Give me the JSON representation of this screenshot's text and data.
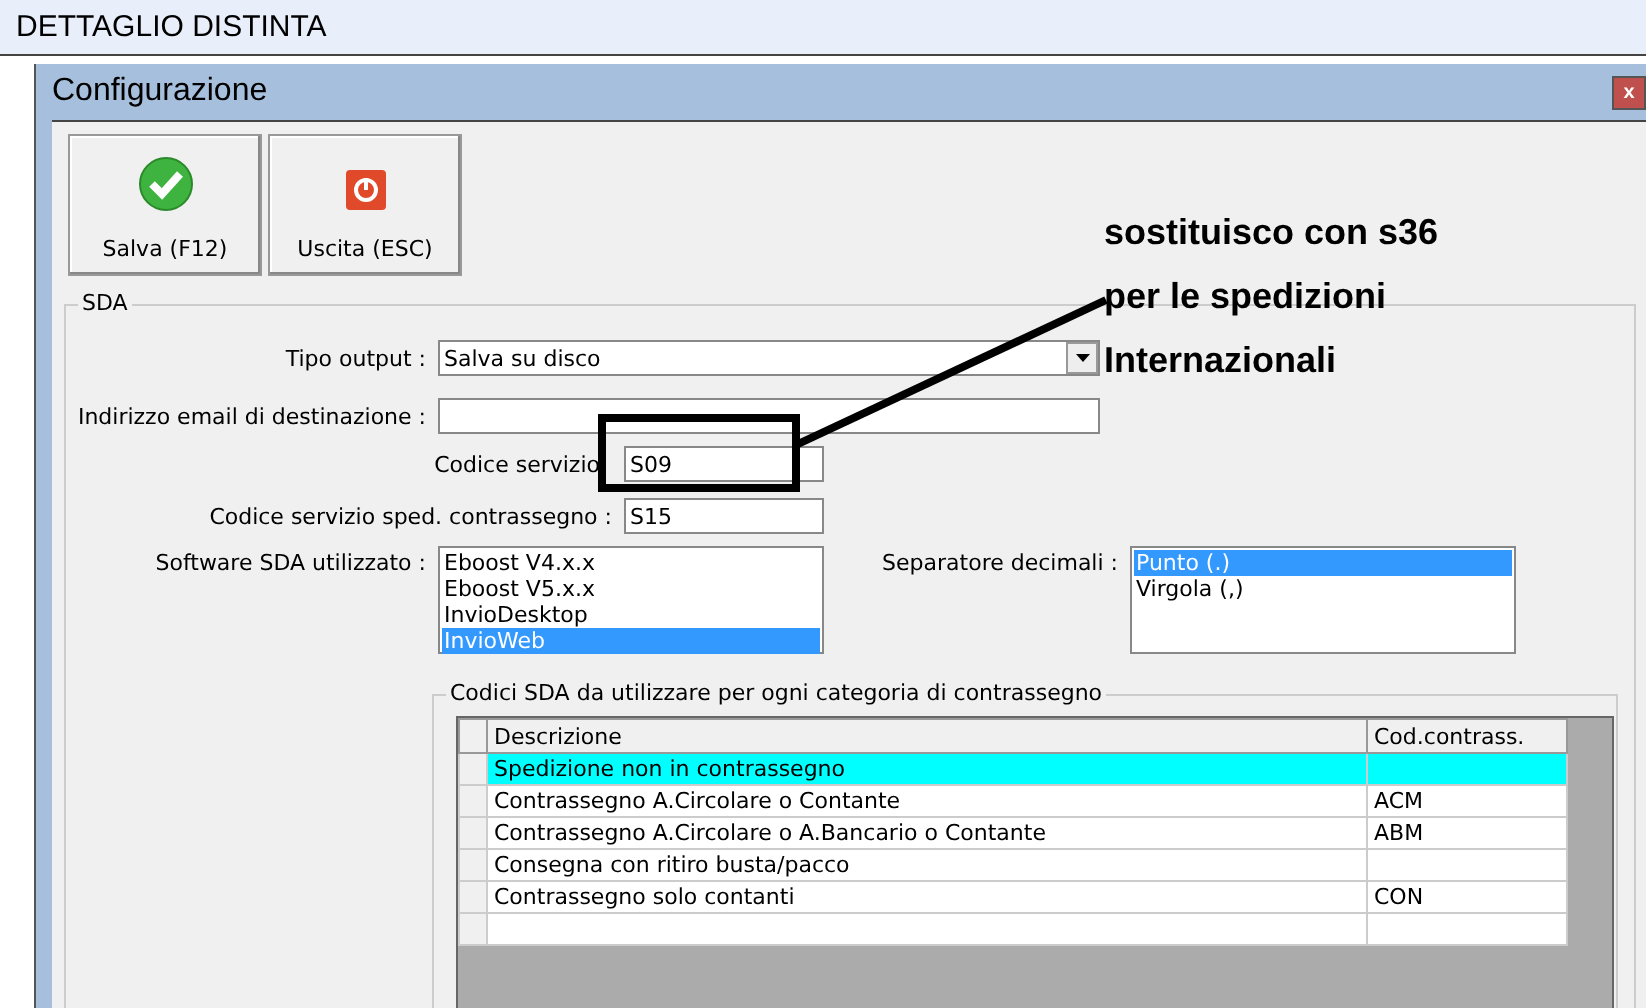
{
  "window": {
    "title": "DETTAGLIO DISTINTA"
  },
  "dialog": {
    "title": "Configurazione",
    "close": "x",
    "toolbar": [
      {
        "kind": "save",
        "label": "Salva (F12)"
      },
      {
        "kind": "exit",
        "label": "Uscita (ESC)"
      }
    ],
    "group": {
      "title": "SDA",
      "output_type": {
        "label": "Tipo output :",
        "value": "Salva su disco"
      },
      "email": {
        "label": "Indirizzo email di destinazione :"
      },
      "service_code": {
        "label": "Codice servizio",
        "value": "S09"
      },
      "cod_service_code": {
        "label": "Codice servizio sped. contrassegno :",
        "value": "S15"
      },
      "software": {
        "label": "Software SDA utilizzato :",
        "items": [
          {
            "label": "Eboost V4.x.x",
            "selected": false
          },
          {
            "label": "Eboost V5.x.x",
            "selected": false
          },
          {
            "label": "InvioDesktop",
            "selected": false
          },
          {
            "label": "InvioWeb",
            "selected": true
          }
        ]
      },
      "decimal_separator": {
        "label": "Separatore decimali :",
        "items": [
          {
            "label": "Punto (.)",
            "selected": true
          },
          {
            "label": "Virgola (,)",
            "selected": false
          }
        ]
      },
      "codes": {
        "title": "Codici SDA da utilizzare per ogni categoria di contrassegno",
        "columns": [
          "Descrizione",
          "Cod.contrass."
        ],
        "rows": [
          {
            "cells": [
              "Spedizione non in contrassegno",
              ""
            ],
            "selected": true
          },
          {
            "cells": [
              "Contrassegno A.Circolare o Contante",
              "ACM"
            ],
            "selected": false
          },
          {
            "cells": [
              "Contrassegno A.Circolare o A.Bancario o Contante",
              "ABM"
            ],
            "selected": false
          },
          {
            "cells": [
              "Consegna con ritiro busta/pacco",
              ""
            ],
            "selected": false
          },
          {
            "cells": [
              "Contrassegno solo contanti",
              "CON"
            ],
            "selected": false
          },
          {
            "cells": [
              "",
              ""
            ],
            "selected": false
          }
        ]
      }
    }
  },
  "annotation": {
    "text": "sostituisco con s36\nper le spedizioni\nInternazionali"
  }
}
